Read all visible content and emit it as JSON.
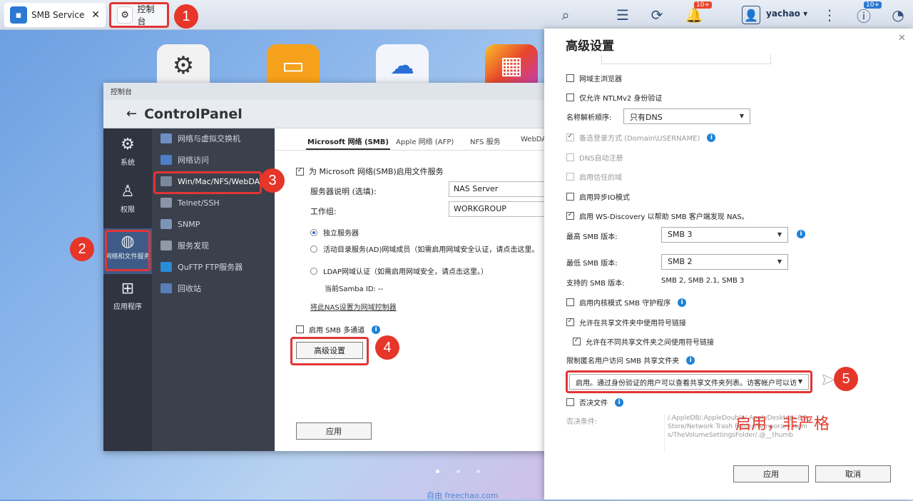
{
  "taskbar": {
    "tab1": "SMB Service",
    "tab1_close": "✕",
    "tab2": "控制台",
    "user": "yachao",
    "notif_badge": "10+",
    "info_badge": "10+"
  },
  "callouts": [
    "1",
    "2",
    "3",
    "4",
    "5"
  ],
  "cp": {
    "window_title": "控制台",
    "header_title": "ControlPanel",
    "side": [
      {
        "label": "系统",
        "icon": "gear-icon"
      },
      {
        "label": "权限",
        "icon": "user-icon"
      },
      {
        "label": "网络和文件服务",
        "icon": "globe-icon"
      },
      {
        "label": "应用程序",
        "icon": "apps-icon"
      }
    ],
    "menu": [
      "网络与虚拟交换机",
      "网络访问",
      "Win/Mac/NFS/WebDAV",
      "Telnet/SSH",
      "SNMP",
      "服务发现",
      "QuFTP FTP服务器",
      "回收站"
    ],
    "tabs": [
      "Microsoft 网络 (SMB)",
      "Apple 网络 (AFP)",
      "NFS 服务",
      "WebDAV"
    ],
    "enable_smb": "为 Microsoft 网络(SMB)启用文件服务",
    "server_desc_label": "服务器说明 (选填):",
    "server_desc_value": "NAS Server",
    "workgroup_label": "工作组:",
    "workgroup_value": "WORKGROUP",
    "radio1": "独立服务器",
    "radio2": "活动目录服务(AD)网域成员（如需启用网域安全认证，请点击这里。",
    "radio3": "LDAP网域认证（如需启用网域安全，请点击这里。）",
    "samba_id": "当前Samba ID:  --",
    "set_dc": "将此NAS设置为网域控制器",
    "multichannel": "启用 SMB 多通道",
    "advanced_btn": "高级设置",
    "apply_btn": "应用"
  },
  "adv": {
    "title": "高级设置",
    "close": "✕",
    "browser": "网域主浏览器",
    "ntlm": "仅允许 NTLMv2 身份验证",
    "name_order_label": "名称解析顺序:",
    "name_order_value": "只有DNS",
    "alt_login": "备选登录方式 (Domain\\USERNAME)",
    "dns_reg": "DNS自动注册",
    "trusted": "启用信任的域",
    "async_io": "启用异步IO模式",
    "wsd": "启用 WS-Discovery 以帮助 SMB 客户端发现 NAS。",
    "max_label": "最高 SMB 版本:",
    "max_value": "SMB 3",
    "min_label": "最低 SMB 版本:",
    "min_value": "SMB 2",
    "supported_label": "支持的 SMB 版本:",
    "supported_value": "SMB 2, SMB 2.1, SMB 3",
    "kernel": "启用内核模式 SMB 守护程序",
    "symlink": "允许在共享文件夹中使用符号链接",
    "symlink_cross": "允许在不同共享文件夹之间使用符号链接",
    "restrict_label": "限制匿名用户访问 SMB 共享文件夹",
    "restrict_value": "启用。通过身份验证的用户可以查看共享文件夹列表。访客帐户可以访",
    "veto": "否决文件",
    "veto_label": "否决条件:",
    "veto_text": "/.AppleDB/.AppleDouble/.AppleDesktop/.DS_Store/Network Trash Folder/Temporary Items/TheVolumeSettingsFolder/.@__thumb",
    "apply": "应用",
    "cancel": "取消"
  },
  "annotation": "启用，非严格",
  "watermark": "自由  freechao.com",
  "colors": {
    "accent": "#1f82d6",
    "callout": "#e63529",
    "annotation": "#e23a2e"
  }
}
